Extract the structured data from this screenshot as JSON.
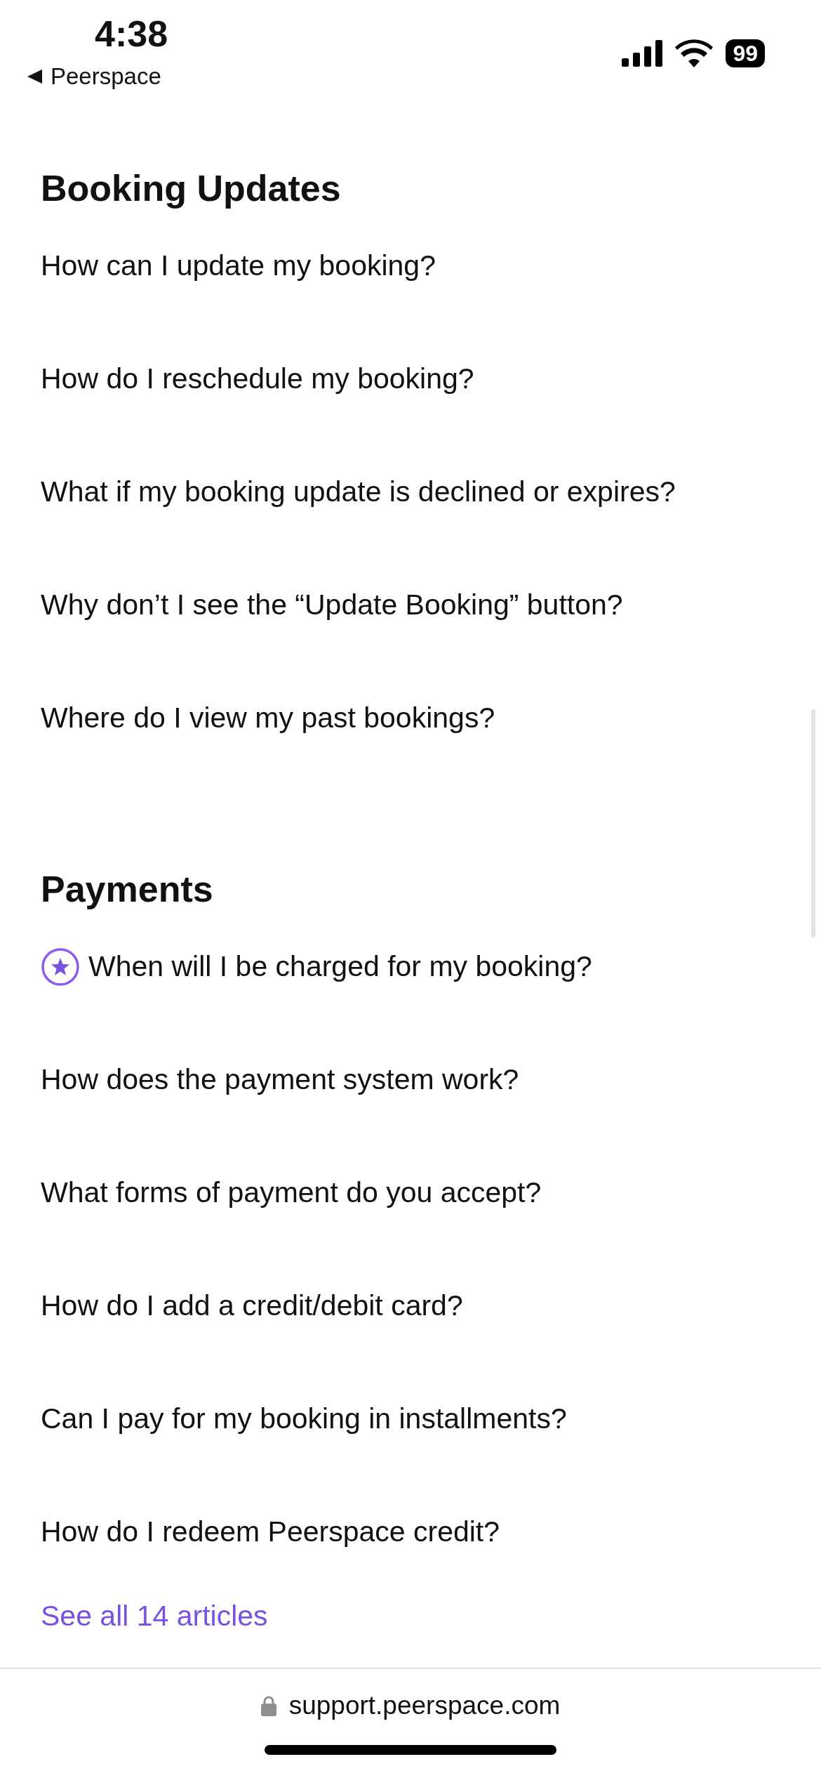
{
  "status_bar": {
    "time": "4:38",
    "back_label": "Peerspace",
    "battery": "99"
  },
  "sections": [
    {
      "title": "Booking Updates",
      "items": [
        {
          "text": "How can I update my booking?",
          "starred": false
        },
        {
          "text": "How do I reschedule my booking?",
          "starred": false
        },
        {
          "text": "What if my booking update is declined or expires?",
          "starred": false
        },
        {
          "text": "Why don’t I see the “Update Booking” button?",
          "starred": false
        },
        {
          "text": "Where do I view my past bookings?",
          "starred": false
        }
      ]
    },
    {
      "title": "Payments",
      "items": [
        {
          "text": "When will I be charged for my booking?",
          "starred": true
        },
        {
          "text": "How does the payment system work?",
          "starred": false
        },
        {
          "text": "What forms of payment do you accept?",
          "starred": false
        },
        {
          "text": "How do I add a credit/debit card?",
          "starred": false
        },
        {
          "text": "Can I pay for my booking in installments?",
          "starred": false
        },
        {
          "text": "How do I redeem Peerspace credit?",
          "starred": false
        }
      ],
      "see_all": "See all 14 articles"
    }
  ],
  "address_bar": {
    "url": "support.peerspace.com"
  }
}
